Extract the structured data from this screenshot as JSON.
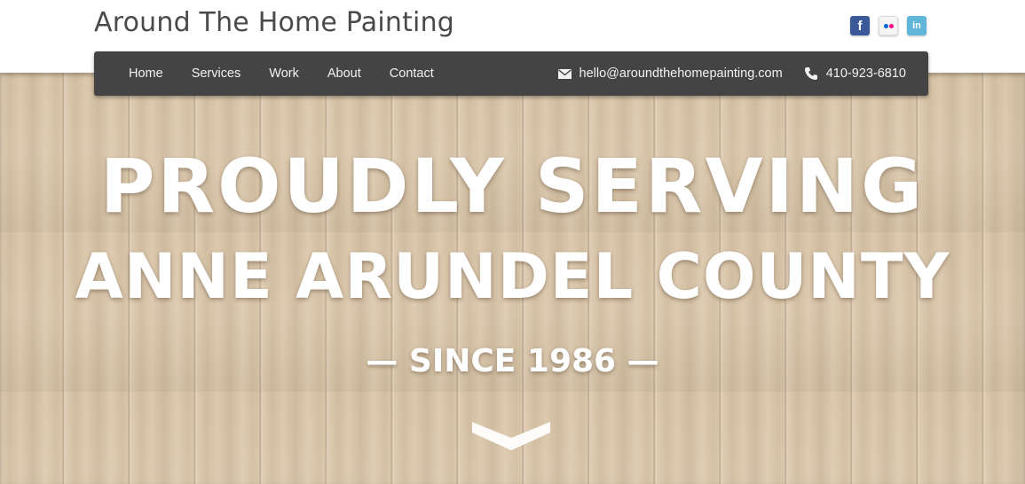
{
  "header": {
    "site_title": "Around The Home Painting",
    "social": [
      {
        "icon": "facebook-icon",
        "glyph": "f",
        "color": "#3b5998"
      },
      {
        "icon": "flickr-icon",
        "glyph": "",
        "color": "#f4f4f4"
      },
      {
        "icon": "linkedin-icon",
        "glyph": "in",
        "color": "#5fb6d8"
      }
    ]
  },
  "nav": {
    "items": [
      {
        "label": "Home"
      },
      {
        "label": "Services"
      },
      {
        "label": "Work"
      },
      {
        "label": "About"
      },
      {
        "label": "Contact"
      }
    ],
    "email": "hello@aroundthehomepainting.com",
    "phone": "410-923-6810",
    "email_icon": "envelope-icon",
    "phone_icon": "phone-icon"
  },
  "hero": {
    "line1": "PROUDLY SERVING",
    "line2": "ANNE ARUNDEL COUNTY",
    "since": "— SINCE 1986 —",
    "scroll_icon": "chevron-down-icon"
  },
  "colors": {
    "nav_bg": "#444444",
    "title_text": "#4a4a4a",
    "hero_wood": "#d9c4a6",
    "hero_text": "#ffffff"
  }
}
